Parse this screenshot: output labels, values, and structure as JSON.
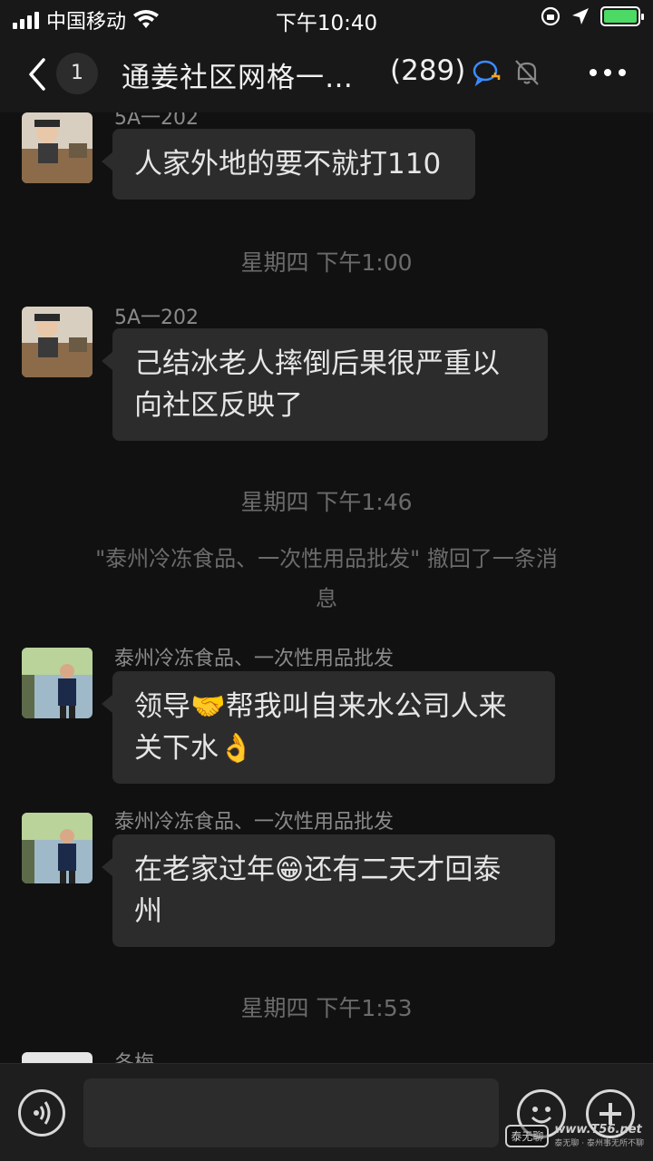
{
  "status_bar": {
    "carrier": "中国移动",
    "time": "下午10:40"
  },
  "nav": {
    "back_badge": "1",
    "title": "通姜社区网格一…",
    "member_count": "(289)"
  },
  "messages": [
    {
      "type": "text",
      "sender": "5A一202",
      "text": "人家外地的要不就打110"
    },
    {
      "type": "time",
      "text": "星期四 下午1:00"
    },
    {
      "type": "text",
      "sender": "5A一202",
      "line1": "己结冰老人摔倒后果很严重以",
      "line2": "向社区反映了"
    },
    {
      "type": "time",
      "text": "星期四 下午1:46"
    },
    {
      "type": "system",
      "line1": "\"泰州冷冻食品、一次性用品批发\" 撤回了一条消",
      "line2": "息"
    },
    {
      "type": "text",
      "sender": "泰州冷冻食品、一次性用品批发",
      "line1": "领导",
      "emoji1": "🤝",
      "line1b": "帮我叫自来水公司人来",
      "line2": "关下水",
      "emoji2": "👌"
    },
    {
      "type": "text",
      "sender": "泰州冷冻食品、一次性用品批发",
      "line1": "在老家过年",
      "emoji1": "😁",
      "line1b": "还有二天才回泰",
      "line2": "州"
    },
    {
      "type": "time",
      "text": "星期四 下午1:53"
    },
    {
      "type": "text",
      "sender": "冬梅"
    }
  ],
  "input": {
    "placeholder": ""
  },
  "watermark": {
    "logo": "泰无聊",
    "site": "www.T56.net",
    "sub": "泰无聊 · 泰州事无所不聊"
  },
  "colors": {
    "background": "#111111",
    "bubble": "#2c2c2c",
    "battery": "#4cd964",
    "accent_icon": "#3b8cff"
  }
}
